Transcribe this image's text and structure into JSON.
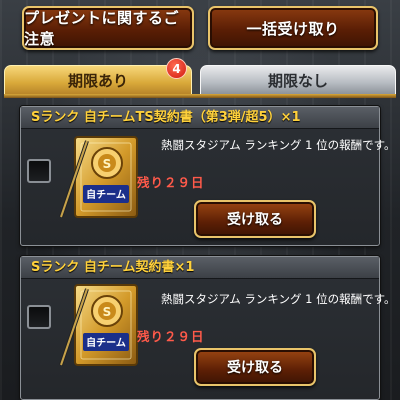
{
  "top_buttons": {
    "notice_label": "プレゼントに関するご注意",
    "receive_all_label": "一括受け取り"
  },
  "tabs": [
    {
      "label": "期限あり",
      "badge": "4",
      "active": true
    },
    {
      "label": "期限なし",
      "active": false
    }
  ],
  "gifts": [
    {
      "title": "Sランク 自チームTS契約書（第3弾/超5）×1",
      "description": "熱闘スタジアム ランキング 1 位の報酬です。",
      "remaining": "残り２９日",
      "receive_label": "受け取る",
      "icon": "contract-scroll-icon",
      "icon_text": "自チーム"
    },
    {
      "title": "Sランク 自チーム契約書×1",
      "description": "熱闘スタジアム ランキング 1 位の報酬です。",
      "remaining": "残り２９日",
      "receive_label": "受け取る",
      "icon": "contract-scroll-icon",
      "icon_text": "自チーム"
    }
  ],
  "colors": {
    "accent_gold": "#e9c46a",
    "title_yellow": "#ffd13b",
    "remaining_red": "#ff5a4a",
    "button_brown": "#5a1e05"
  }
}
